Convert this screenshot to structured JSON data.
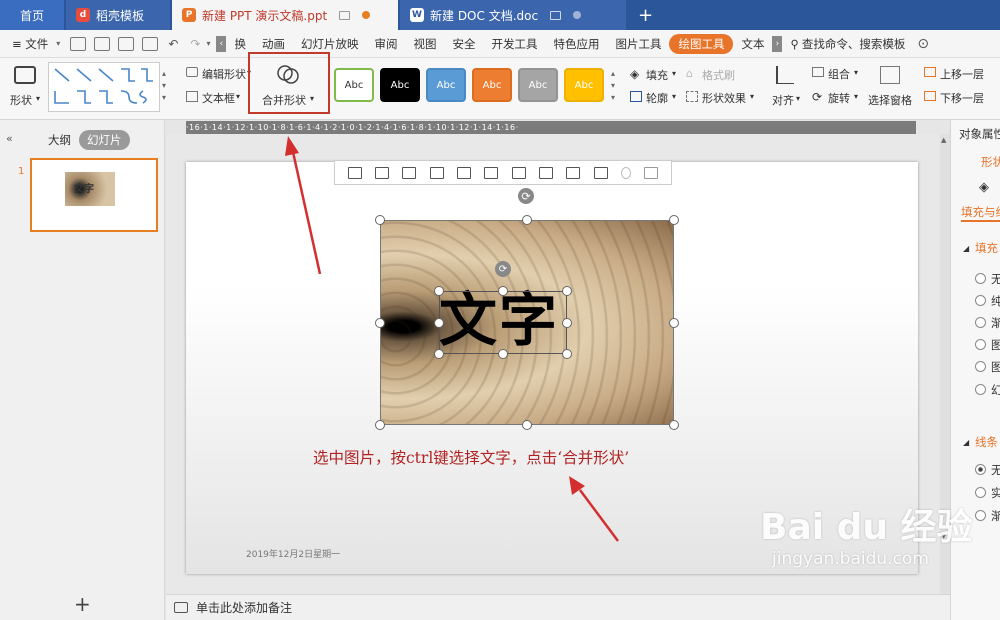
{
  "tabs": {
    "home": "首页",
    "items": [
      {
        "label": "稻壳模板",
        "icon_color": "#e74c3c",
        "icon_glyph": "d",
        "active": false
      },
      {
        "label": "新建 PPT 演示文稿.ppt",
        "icon_color": "#e8742a",
        "icon_glyph": "P",
        "active": true
      },
      {
        "label": "新建 DOC 文档.doc",
        "icon_color": "#2b579a",
        "icon_glyph": "W",
        "active": false
      }
    ],
    "add": "+"
  },
  "menu": {
    "file": "≡ 文件",
    "items": [
      "换",
      "动画",
      "幻灯片放映",
      "审阅",
      "视图",
      "安全",
      "开发工具",
      "特色应用",
      "图片工具",
      "绘图工具",
      "文本"
    ],
    "active_item": "绘图工具",
    "search": "查找命令、搜索模板"
  },
  "ribbon": {
    "shape": "形状",
    "edit_shape": "编辑形状",
    "text_box": "文本框",
    "merge_shape": "合并形状",
    "style_label": "Abc",
    "styles": [
      {
        "bg": "#ffffff",
        "fg": "#333333",
        "border": "#7fba4a"
      },
      {
        "bg": "#000000",
        "fg": "#ffffff",
        "border": "#000000"
      },
      {
        "bg": "#5b9bd5",
        "fg": "#ffffff",
        "border": "#4a8ac4"
      },
      {
        "bg": "#ed7d31",
        "fg": "#ffffff",
        "border": "#dc6c20"
      },
      {
        "bg": "#a5a5a5",
        "fg": "#ffffff",
        "border": "#949494"
      },
      {
        "bg": "#ffc000",
        "fg": "#ffffff",
        "border": "#eeaf00"
      }
    ],
    "fill": "填充",
    "outline": "轮廓",
    "format_painter": "格式刷",
    "shape_effect": "形状效果",
    "align": "对齐",
    "group": "组合",
    "rotate": "旋转",
    "selection_pane": "选择窗格",
    "bring_forward": "上移一层",
    "send_backward": "下移一层"
  },
  "left_panel": {
    "outline_tab": "大纲",
    "slides_tab": "幻灯片",
    "slide_number": "1"
  },
  "ruler": "·16·1·14·1·12·1·10·1·8·1·6·1·4·1·2·1·0·1·2·1·4·1·6·1·8·1·10·1·12·1·14·1·16·",
  "slide": {
    "big_text": "文字",
    "instruction": "选中图片，按ctrl键选择文字，点击‘合并形状’",
    "date": "2019年12月2日星期一"
  },
  "notes": {
    "placeholder": "单击此处添加备注",
    "add": "+"
  },
  "right_panel": {
    "title": "对象属性",
    "tab_shape": "形状",
    "fill_line": "填充与线",
    "fill_section": "填充",
    "fill_options": [
      "无",
      "纯",
      "渐",
      "图",
      "图",
      "幻"
    ],
    "line_section": "线条",
    "line_options": [
      "无",
      "实",
      "渐"
    ]
  },
  "watermark": {
    "logo": "Bai du 经验",
    "url": "jingyan.baidu.com"
  },
  "colors": {
    "accent_orange": "#e8742a",
    "annotation_red": "#c0392b",
    "title_blue": "#2b579a"
  }
}
